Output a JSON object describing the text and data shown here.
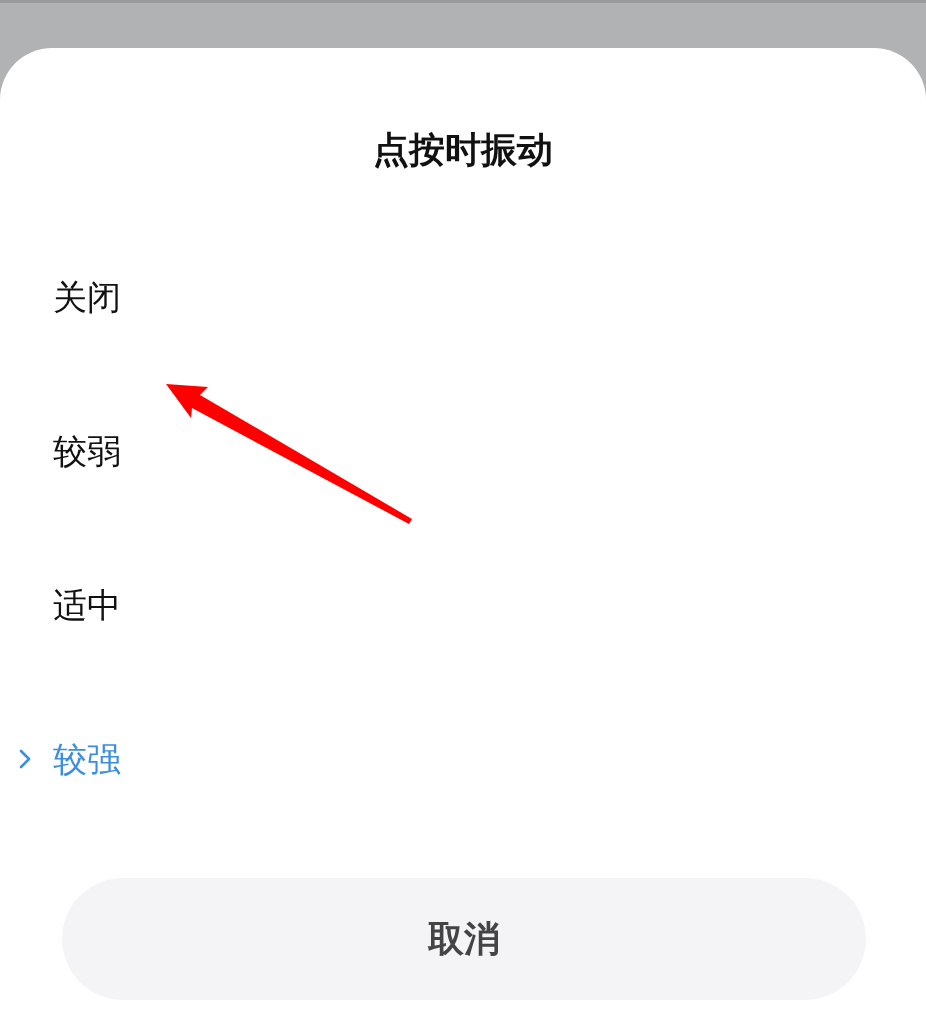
{
  "dialog": {
    "title": "点按时振动"
  },
  "options": [
    {
      "label": "关闭",
      "selected": false
    },
    {
      "label": "较弱",
      "selected": false
    },
    {
      "label": "适中",
      "selected": false
    },
    {
      "label": "较强",
      "selected": true
    }
  ],
  "cancel_button": {
    "label": "取消"
  }
}
